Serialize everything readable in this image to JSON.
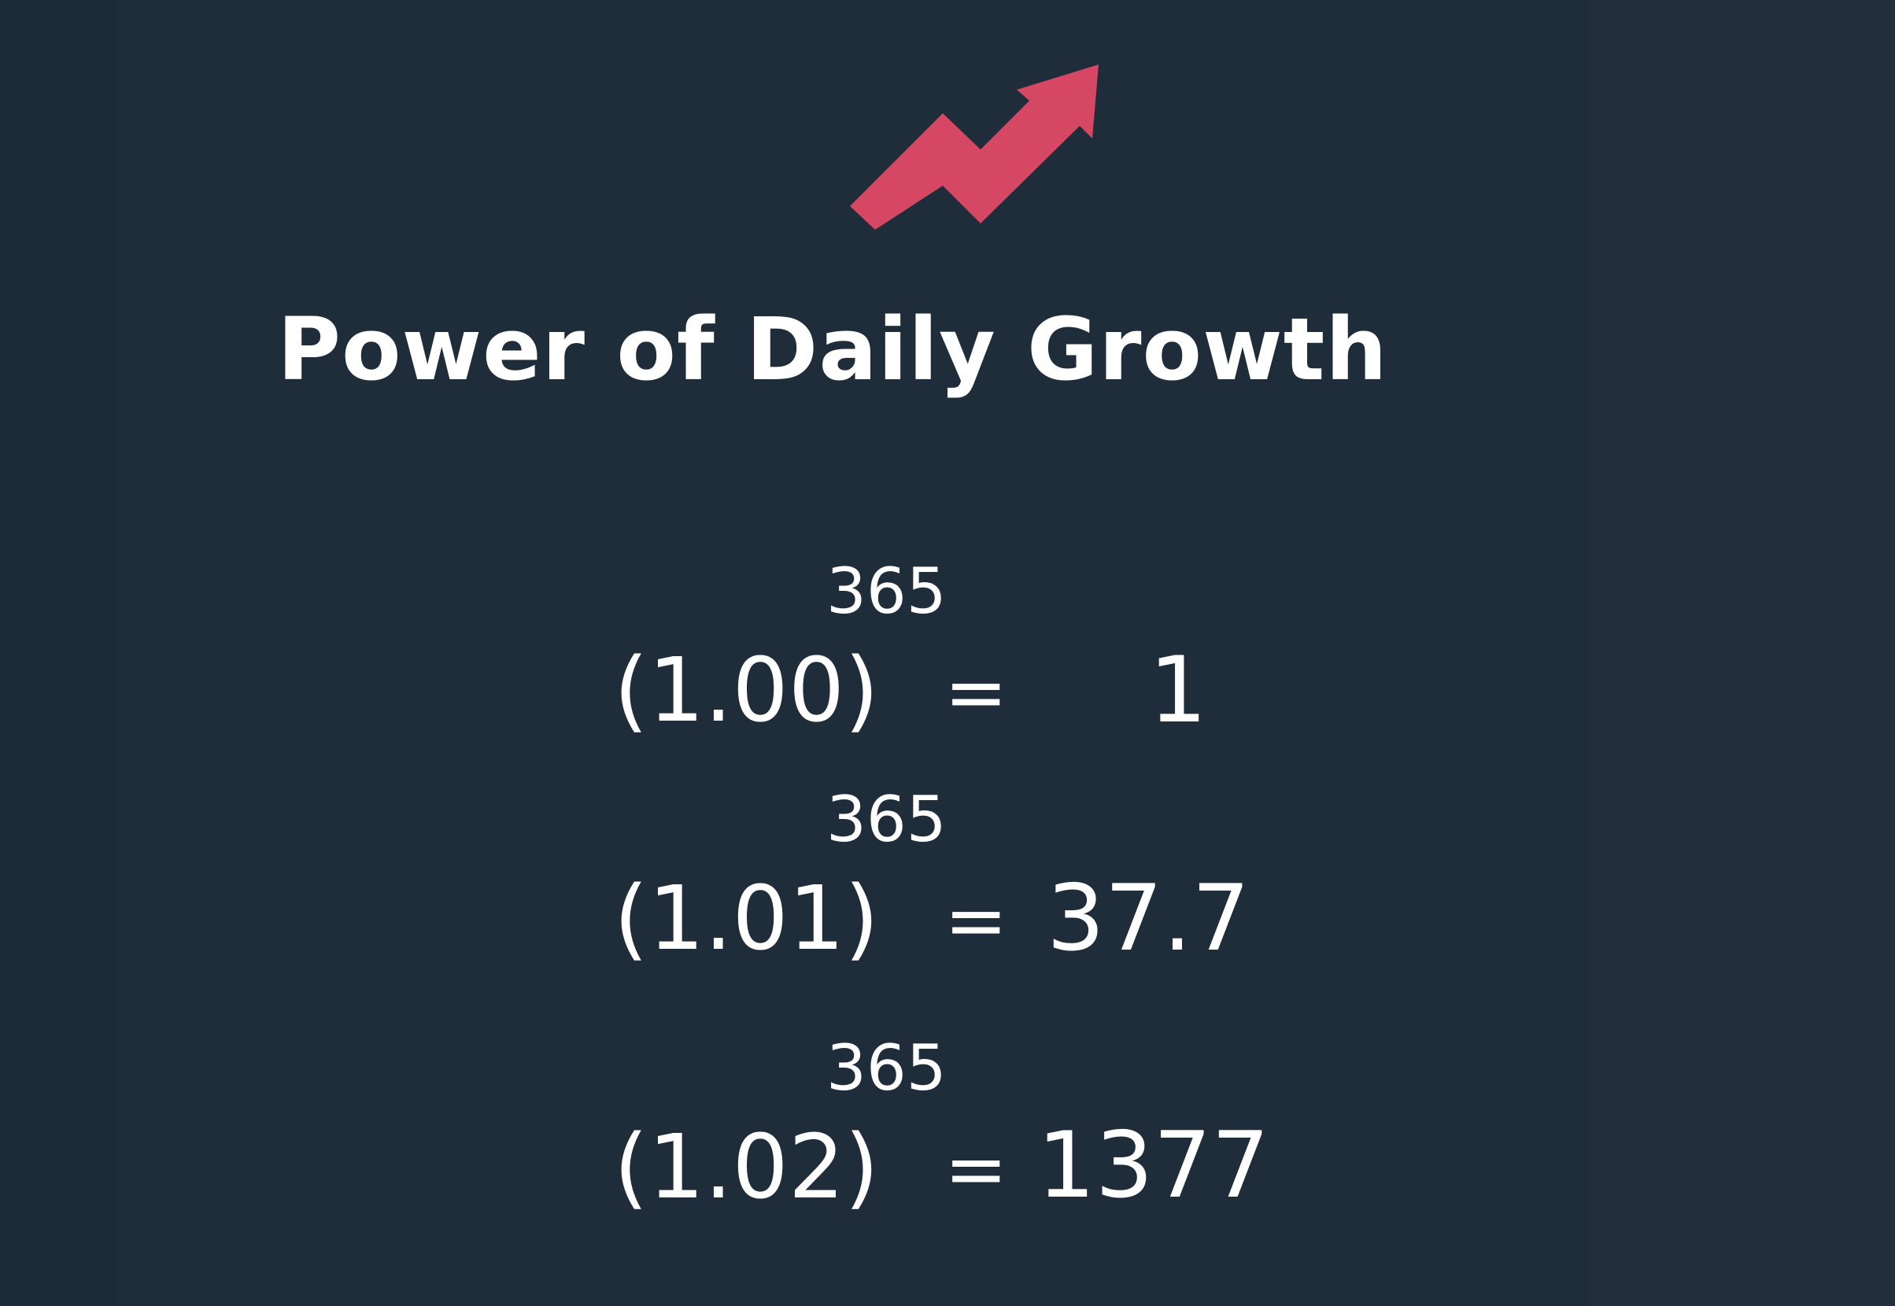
{
  "title": "Power of Daily Growth",
  "colors": {
    "background": "#1f2d3a",
    "arrow": "#d64763",
    "text": "#ffffff"
  },
  "icon": "growth-arrow-icon",
  "equations": [
    {
      "base": "(1.00)",
      "exponent": "365",
      "equals": "=",
      "result": "1"
    },
    {
      "base": "(1.01)",
      "exponent": "365",
      "equals": "=",
      "result": "37.7"
    },
    {
      "base": "(1.02)",
      "exponent": "365",
      "equals": "=",
      "result": "1377"
    }
  ]
}
